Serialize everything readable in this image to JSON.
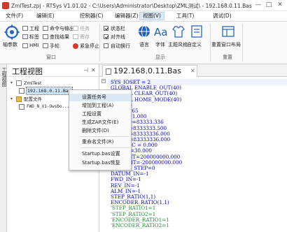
{
  "window": {
    "title": "ZmlTest.zpj - RTSys V1.01.02 - C:\\Users\\Administrator\\Desktop\\ZML测试\\ - 192.168.0.11.Bas",
    "minimize_glyph": "—",
    "restore_glyph": "□",
    "close_glyph": "✕"
  },
  "menu": [
    "文件(F)",
    "编辑(E)",
    "控制器(C)",
    "编辑器(Z)",
    "视图(V)",
    "工具(T)",
    "调试(D)"
  ],
  "ribbon": {
    "window_group": {
      "title": "窗口",
      "big_button": "轴参数",
      "items": [
        "工程",
        "命令与输出",
        "任务",
        "标签",
        "查找结果",
        "寄存",
        "HMI",
        "手轮",
        "紧急停止"
      ]
    },
    "display_group": {
      "title": "显示",
      "checkboxes": [
        "状态栏",
        "对齐线",
        "自动换行"
      ],
      "buttons": [
        "语言",
        "字体",
        "主题风格",
        "自定义"
      ]
    },
    "reset_group": {
      "title": "重置",
      "buttons": [
        "重置窗口布局"
      ]
    }
  },
  "left_tab": "工程视图",
  "panel": {
    "title": "工程视图",
    "pin_glyph": "⊣",
    "close_glyph": "✕",
    "tree": [
      {
        "label": "ZmlTest",
        "level": 0,
        "twist": "▾"
      },
      {
        "label": "192.168.0.11.Bas",
        "level": 1,
        "selected": true
      },
      {
        "label": "配置文件",
        "level": 0,
        "twist": "▾"
      },
      {
        "label": "FWD_N_V1-Owsbo...",
        "level": 1
      }
    ]
  },
  "context_menu": {
    "items": [
      "设置任务号",
      "增加到工程(A)",
      "工程设置",
      "生成ZAR文件(E)",
      "删除文件(D)",
      "重命名文件(R)",
      "Startup.bas设置",
      "Startup.bas恢复"
    ],
    "highlighted_index": 0
  },
  "editor": {
    "tab_label": "192.168.0.11.Bas",
    "tab_close": "✕",
    "fold_glyph": "−",
    "lines": [
      {
        "text": "SYS_IOSET = 2"
      },
      {
        "text": "GLOBAL ENABLE_OUT(40)"
      },
      {
        "text": "GLOBAL CLEAR_OUT(40)"
      },
      {
        "text": "GLOBAL HOME_MODE(40)"
      },
      {
        "text": "BASE(0)"
      },
      {
        "text": "ATYPE=65"
      },
      {
        "text": "UNITS=1.000"
      },
      {
        "text": "LSPEED=83333.336"
      },
      {
        "text": "SPEED=8333333.500"
      },
      {
        "text": "ACCEL=83333336.000"
      },
      {
        "text": "DECEL=83333336.000"
      },
      {
        "text": "FASTDEC = 0.000"
      },
      {
        "text": "SRAMP=30.000"
      },
      {
        "text": "FS_LIMIT=200000000.000"
      },
      {
        "text": "RS_LIMIT=-200000000.000"
      },
      {
        "text": "INVERT_STEP=0"
      },
      {
        "text": "DATUM_IN=-1"
      },
      {
        "text": "FWD_IN=-1"
      },
      {
        "text": "REV_IN=-1"
      },
      {
        "text": "ALM_IN=-1"
      },
      {
        "text": "STEP_RATIO(1,1)"
      },
      {
        "text": "ENCODER_RATIO(1,1)"
      },
      {
        "text": "'STEP_RATIO1=1",
        "comment": true
      },
      {
        "text": "'STEP_RATIO2=1",
        "comment": true
      },
      {
        "text": "'ENCODER_RATIO1=1",
        "comment": true
      },
      {
        "text": "'ENCODER_RATIO2=1",
        "comment": true
      }
    ]
  },
  "colors": {
    "keyword_blue": "#0000d8",
    "comment_green": "#1f8f3a",
    "ribbon_accent": "#2a66c4",
    "logo_red": "#d9362b"
  }
}
